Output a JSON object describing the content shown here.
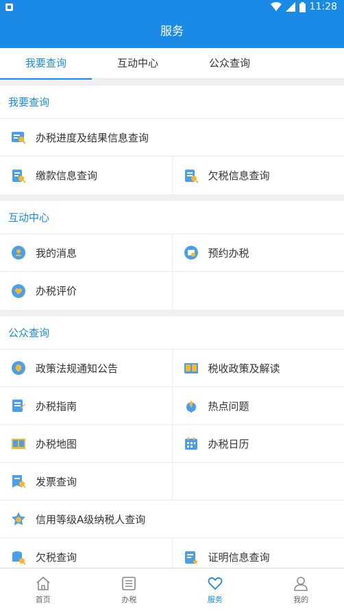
{
  "status": {
    "time": "11:28"
  },
  "header": {
    "title": "服务"
  },
  "tabs": [
    {
      "label": "我要查询"
    },
    {
      "label": "互动中心"
    },
    {
      "label": "公众查询"
    }
  ],
  "sections": {
    "query": {
      "title": "我要查询",
      "items": [
        {
          "label": "办税进度及结果信息查询",
          "icon": "progress-search-icon"
        },
        {
          "label": "缴款信息查询",
          "icon": "payment-search-icon"
        },
        {
          "label": "欠税信息查询",
          "icon": "arrears-search-icon"
        }
      ]
    },
    "interact": {
      "title": "互动中心",
      "items": [
        {
          "label": "我的消息",
          "icon": "message-icon"
        },
        {
          "label": "预约办税",
          "icon": "appointment-icon"
        },
        {
          "label": "办税评价",
          "icon": "evaluation-icon"
        }
      ]
    },
    "public": {
      "title": "公众查询",
      "items": [
        {
          "label": "政策法规通知公告",
          "icon": "bell-icon"
        },
        {
          "label": "税收政策及解读",
          "icon": "book-icon"
        },
        {
          "label": "办税指南",
          "icon": "guide-icon"
        },
        {
          "label": "热点问题",
          "icon": "hot-icon"
        },
        {
          "label": "办税地图",
          "icon": "map-book-icon"
        },
        {
          "label": "办税日历",
          "icon": "calendar-icon"
        },
        {
          "label": "发票查询",
          "icon": "invoice-search-icon"
        },
        {
          "label": "信用等级A级纳税人查询",
          "icon": "credit-badge-icon"
        },
        {
          "label": "欠税查询",
          "icon": "arrears-query-icon"
        },
        {
          "label": "证明信息查询",
          "icon": "certificate-icon"
        }
      ]
    }
  },
  "bottom_nav": [
    {
      "label": "首页",
      "icon": "home-icon"
    },
    {
      "label": "办税",
      "icon": "list-icon"
    },
    {
      "label": "服务",
      "icon": "heart-icon"
    },
    {
      "label": "我的",
      "icon": "user-icon"
    }
  ],
  "colors": {
    "primary": "#1a8ae6",
    "icon_yellow": "#f5b92e",
    "background": "#efefef"
  }
}
